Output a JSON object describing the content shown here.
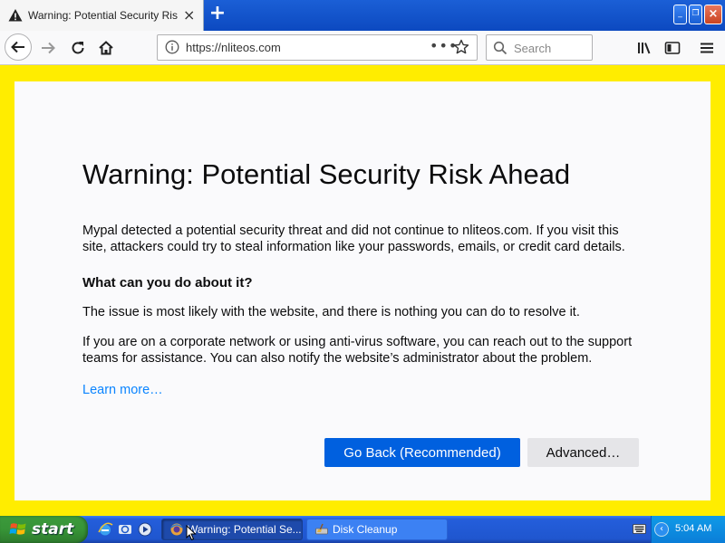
{
  "browser": {
    "tab": {
      "title": "Warning: Potential Security Risk Ah",
      "close_icon": "×"
    },
    "new_tab_icon": "+",
    "window_controls": {
      "minimize": "_",
      "restore": "❐",
      "close": "×"
    },
    "url": "https://nliteos.com",
    "url_dots": "•••",
    "search_placeholder": "Search"
  },
  "page": {
    "title": "Warning: Potential Security Risk Ahead",
    "intro": "Mypal detected a potential security threat and did not continue to nliteos.com. If you visit this site, attackers could try to steal information like your passwords, emails, or credit card details.",
    "subheading": "What can you do about it?",
    "para1": "The issue is most likely with the website, and there is nothing you can do to resolve it.",
    "para2": "If you are on a corporate network or using anti-virus software, you can reach out to the support teams for assistance. You can also notify the website’s administrator about the problem.",
    "learn_more": "Learn more…",
    "go_back_label": "Go Back (Recommended)",
    "advanced_label": "Advanced…"
  },
  "taskbar": {
    "start_label": "start",
    "tasks": [
      {
        "label": "Warning: Potential Se...",
        "icon": "mypal-icon"
      },
      {
        "label": "Disk Cleanup",
        "icon": "disk-cleanup-icon"
      }
    ],
    "clock": "5:04 AM"
  },
  "colors": {
    "accent": "#0060df",
    "link": "#0a84ff",
    "frame": "#ffed00",
    "taskbar": "#245edb",
    "start": "#379437"
  }
}
